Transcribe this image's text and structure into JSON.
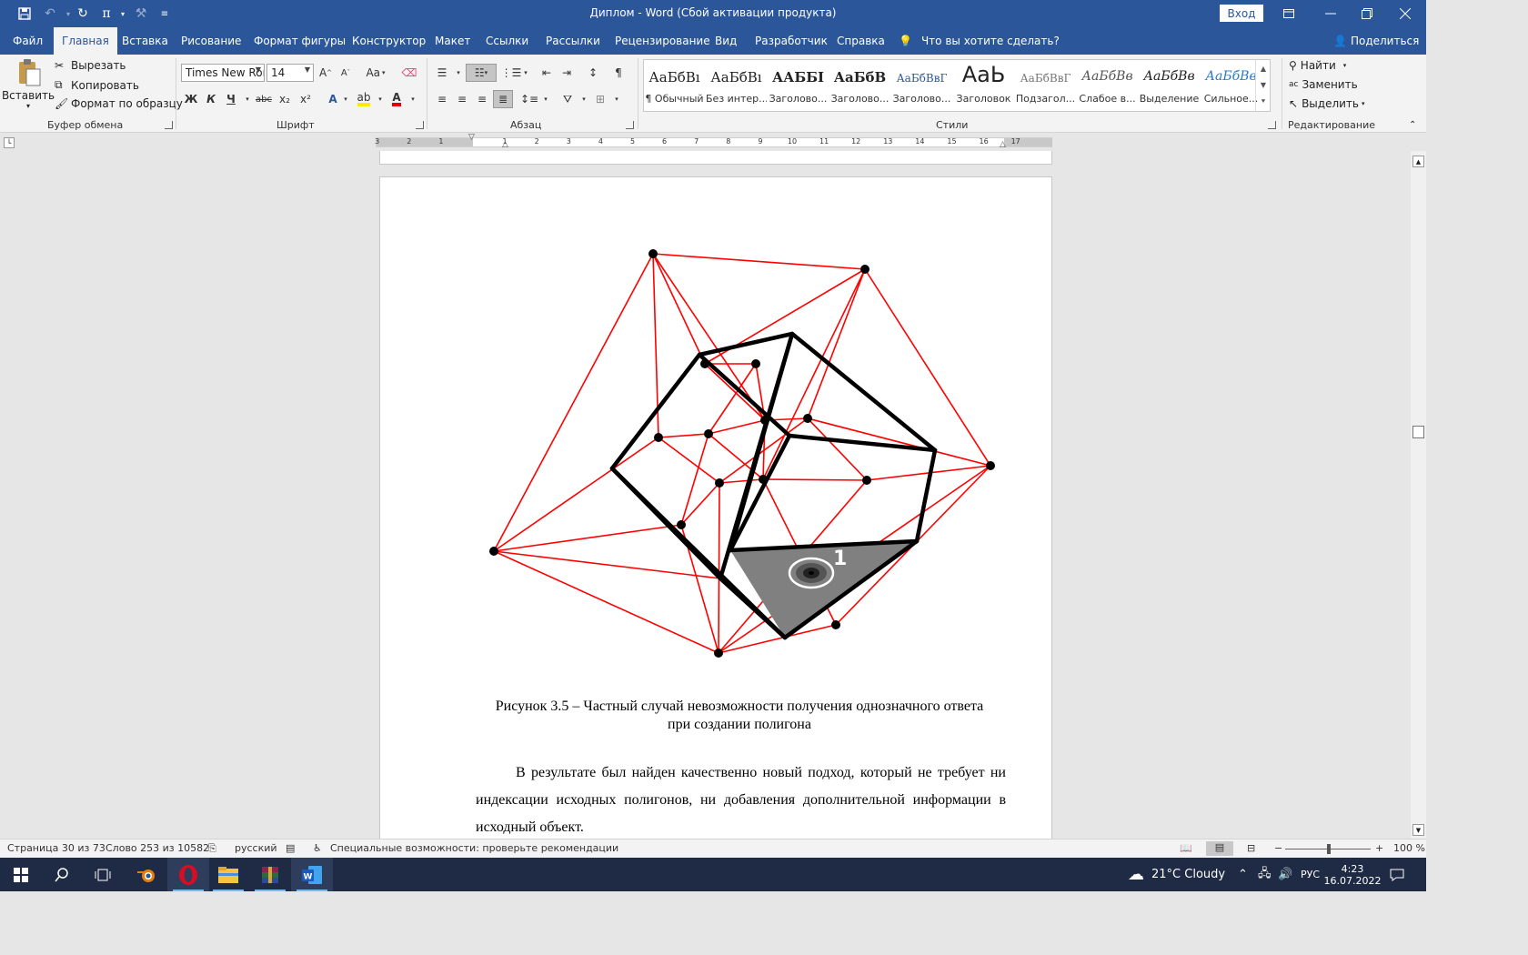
{
  "titlebar": {
    "title": "Диплом  -  Word (Сбой активации продукта)",
    "login": "Вход",
    "pi_symbol": "π",
    "icons": [
      "save-icon",
      "undo-icon",
      "redo-icon",
      "pi-icon",
      "format-painter-icon",
      "customize-icon"
    ]
  },
  "tabs": {
    "items": [
      "Файл",
      "Главная",
      "Вставка",
      "Рисование",
      "Формат фигуры",
      "Конструктор",
      "Макет",
      "Ссылки",
      "Рассылки",
      "Рецензирование",
      "Вид",
      "Разработчик",
      "Справка"
    ],
    "active": "Главная",
    "tell_me": "Что вы хотите сделать?",
    "share": "Поделиться"
  },
  "ribbon": {
    "clipboard": {
      "paste": "Вставить",
      "cut": "Вырезать",
      "copy": "Копировать",
      "format_painter": "Формат по образцу",
      "label": "Буфер обмена"
    },
    "font": {
      "font_name": "Times New Ron",
      "font_size": "14",
      "bold": "Ж",
      "italic": "К",
      "underline": "Ч",
      "strike": "abc",
      "subscript": "x₂",
      "superscript": "x²",
      "case": "Aa",
      "label": "Шрифт"
    },
    "paragraph": {
      "label": "Абзац"
    },
    "styles": {
      "label": "Стили",
      "items": [
        {
          "sample": "АаБбВı",
          "name": "¶ Обычный"
        },
        {
          "sample": "АаБбВı",
          "name": "Без интер..."
        },
        {
          "sample": "ААББІ",
          "name": "Заголово..."
        },
        {
          "sample": "АаБбВ",
          "name": "Заголово..."
        },
        {
          "sample": "АаБбВвГ",
          "name": "Заголово..."
        },
        {
          "sample": "АаЬ",
          "name": "Заголовок"
        },
        {
          "sample": "АаБбВвГ",
          "name": "Подзагол..."
        },
        {
          "sample": "АаБбВв",
          "name": "Слабое в..."
        },
        {
          "sample": "АаБбВв",
          "name": "Выделение"
        },
        {
          "sample": "АаБбВв",
          "name": "Сильное..."
        }
      ]
    },
    "editing": {
      "find": "Найти",
      "replace": "Заменить",
      "select": "Выделить",
      "label": "Редактирование"
    }
  },
  "ruler": {
    "ticks": [
      "3",
      "2",
      "1",
      "1",
      "2",
      "3",
      "4",
      "5",
      "6",
      "7",
      "8",
      "9",
      "10",
      "11",
      "12",
      "13",
      "14",
      "15",
      "16",
      "17"
    ]
  },
  "document": {
    "figure_label": "1",
    "caption_line1": "Рисунок 3.5 – Частный случай невозможности получения однозначного ответа",
    "caption_line2": "при создании полигона",
    "body": "В результате был найден качественно новый подход, который не требует ни индексации исходных полигонов, ни добавления дополнительной информации в исходный объект.",
    "colors": {
      "red_edges": "#ff0000",
      "black_edges": "#000000",
      "triangle_fill": "#808080"
    }
  },
  "statusbar": {
    "page": "Страница 30 из 73",
    "words": "Слово 253 из 10582",
    "language": "русский",
    "accessibility": "Специальные возможности: проверьте рекомендации",
    "zoom": "100 %",
    "minus": "−",
    "plus": "+"
  },
  "taskbar": {
    "weather": "21°C  Cloudy",
    "lang": "РУС",
    "time": "4:23",
    "date": "16.07.2022",
    "apps": [
      "windows-start-icon",
      "search-icon",
      "task-view-icon",
      "blender-icon",
      "opera-icon",
      "file-explorer-icon",
      "winrar-icon",
      "word-icon"
    ]
  }
}
